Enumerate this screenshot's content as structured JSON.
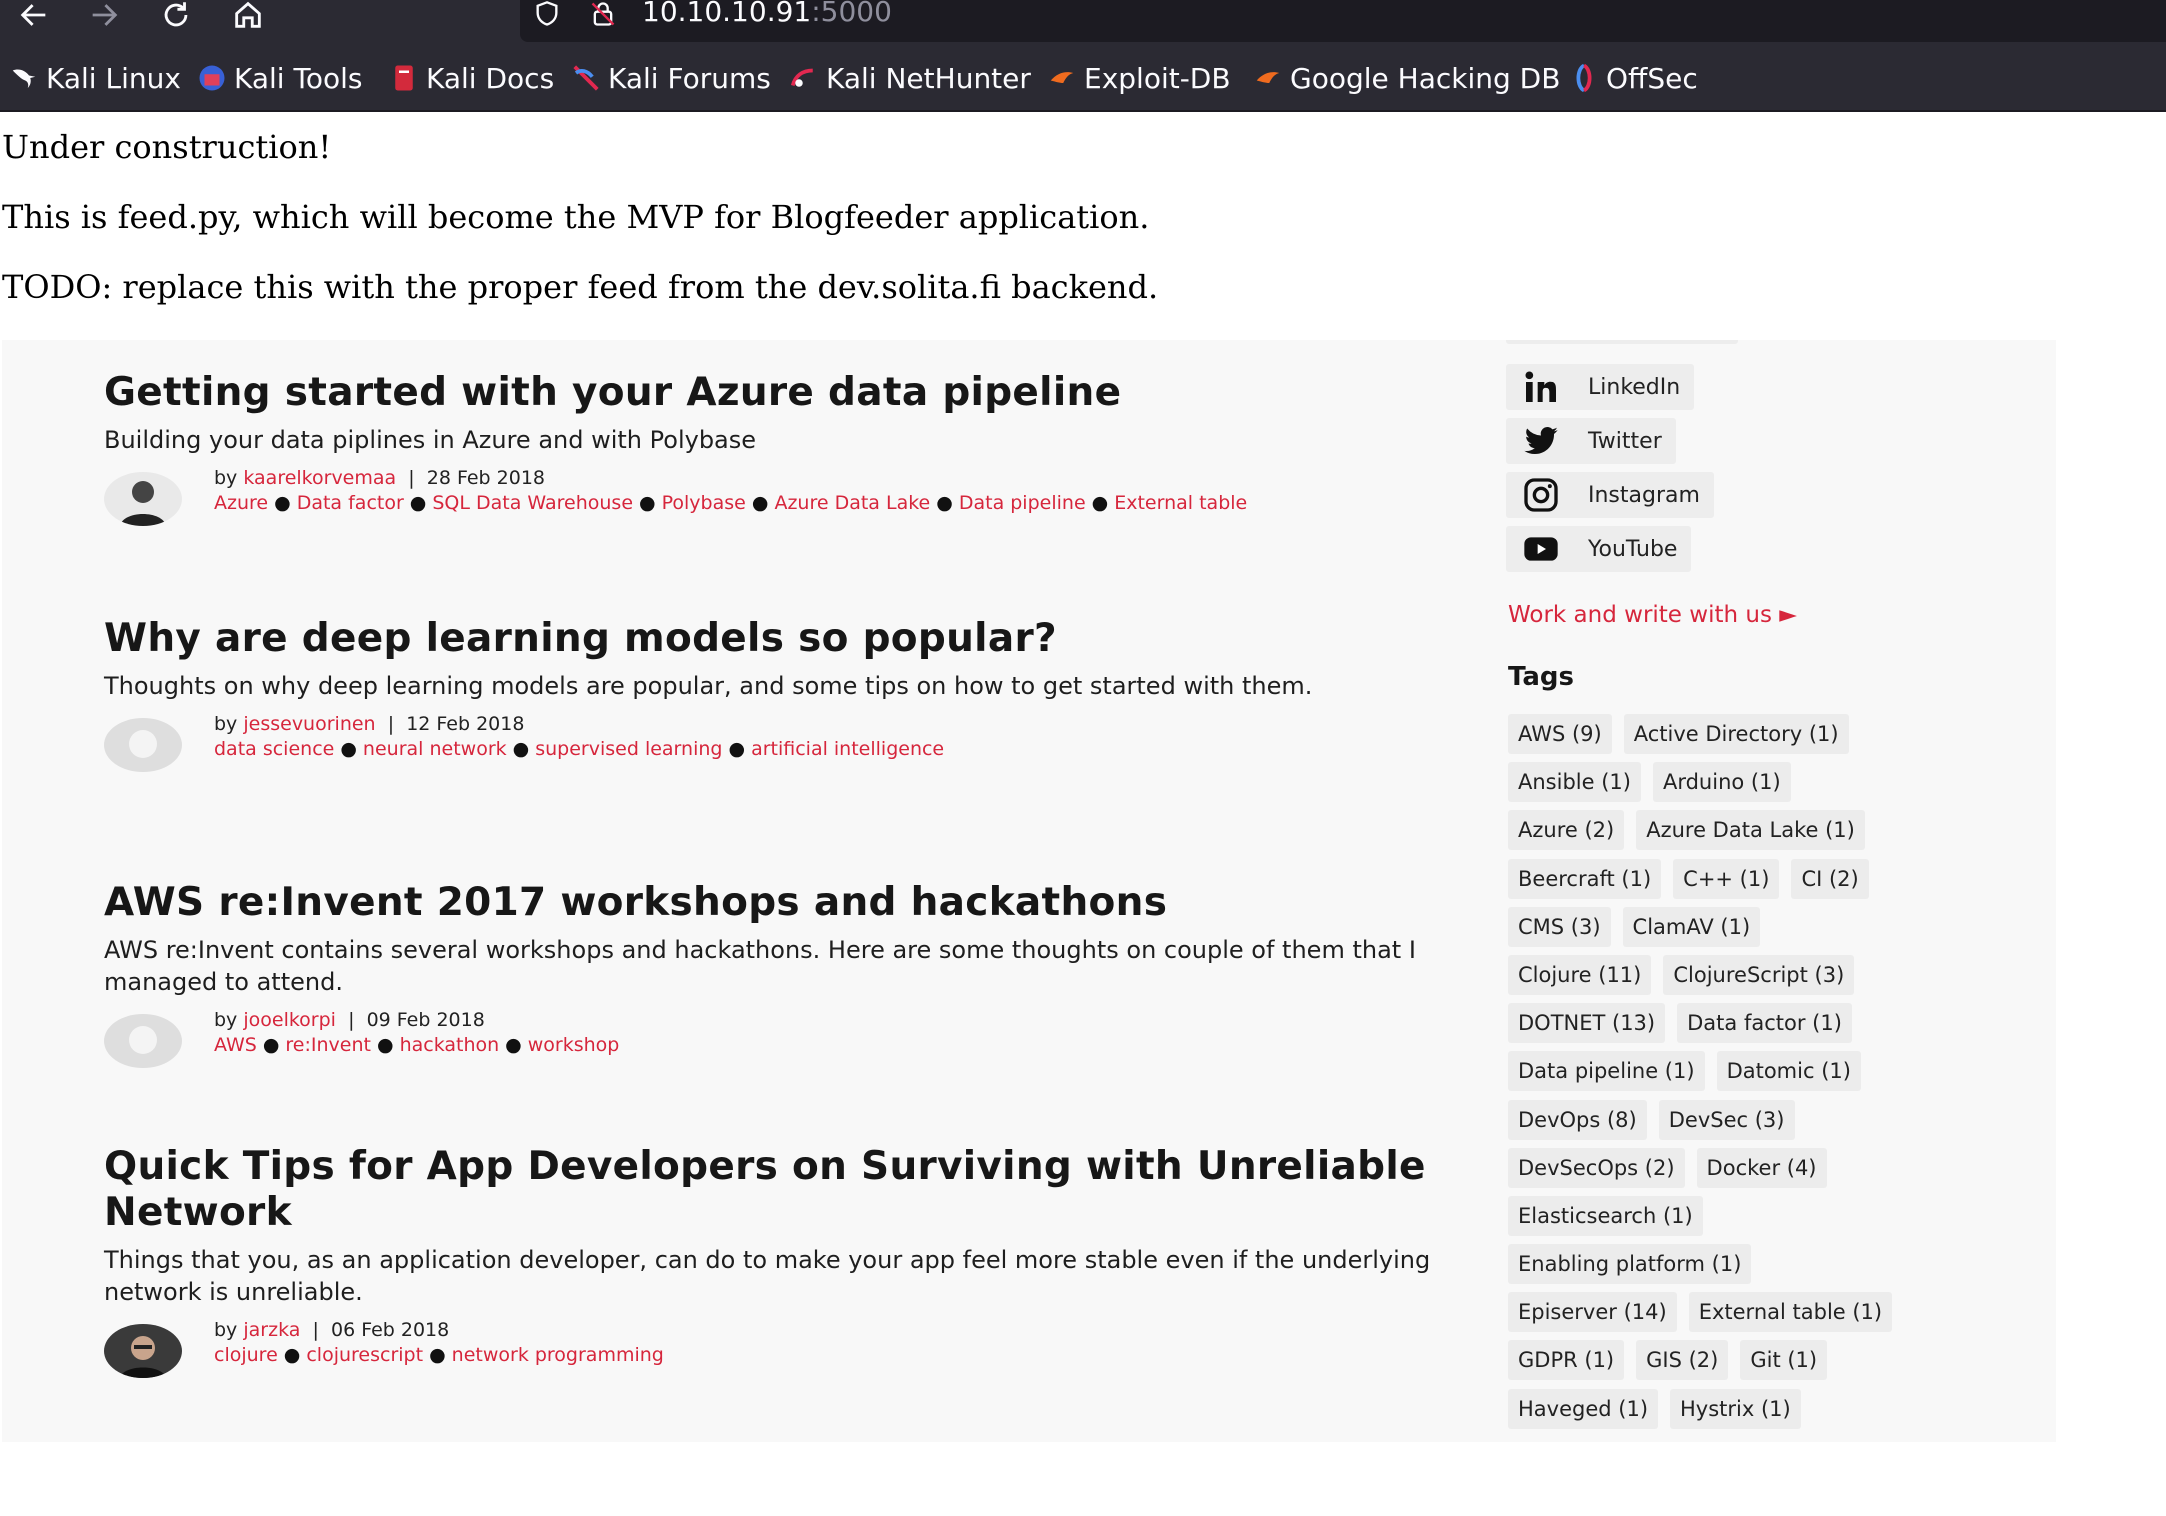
{
  "browser": {
    "url_host": "10.10.10.91",
    "url_port": ":5000",
    "nav_icons": [
      "back-arrow-icon",
      "forward-arrow-icon",
      "reload-icon",
      "home-icon"
    ],
    "bookmarks": [
      {
        "label": "Kali Linux",
        "icon": "kali-dragon-icon"
      },
      {
        "label": "Kali Tools",
        "icon": "kali-tools-icon"
      },
      {
        "label": "Kali Docs",
        "icon": "kali-docs-icon"
      },
      {
        "label": "Kali Forums",
        "icon": "kali-forums-icon"
      },
      {
        "label": "Kali NetHunter",
        "icon": "kali-nethunter-icon"
      },
      {
        "label": "Exploit-DB",
        "icon": "exploit-db-icon"
      },
      {
        "label": "Google Hacking DB",
        "icon": "ghdb-icon"
      },
      {
        "label": "OffSec",
        "icon": "offsec-icon"
      }
    ],
    "colors": {
      "toolbar": "#2b2a33",
      "urlbar": "#1c1b22"
    }
  },
  "page": {
    "line1": "Under construction!",
    "line2": "This is feed.py, which will become the MVP for Blogfeeder application.",
    "line3": "TODO: replace this with the proper feed from the dev.solita.fi backend."
  },
  "blog": {
    "accent_color": "#d6263c",
    "posts": [
      {
        "title": "Getting started with your Azure data pipeline",
        "summary": "Building your data piplines in Azure and with Polybase",
        "by": "by ",
        "author": "kaarelkorvemaa",
        "separator": "|",
        "date": "28 Feb 2018",
        "tags": [
          "Azure",
          "Data factor",
          "SQL Data Warehouse",
          "Polybase",
          "Azure Data Lake",
          "Data pipeline",
          "External table"
        ]
      },
      {
        "title": "Why are deep learning models so popular?",
        "summary": "Thoughts on why deep learning models are popular, and some tips on how to get started with them.",
        "by": "by ",
        "author": "jessevuorinen",
        "separator": "|",
        "date": "12 Feb 2018",
        "tags": [
          "data science",
          "neural network",
          "supervised learning",
          "artificial intelligence"
        ]
      },
      {
        "title": "AWS re:Invent 2017 workshops and hackathons",
        "summary": "AWS re:Invent contains several workshops and hackathons. Here are some thoughts on couple of them that I managed to attend.",
        "by": "by ",
        "author": "jooelkorpi",
        "separator": "|",
        "date": "09 Feb 2018",
        "tags": [
          "AWS",
          "re:Invent",
          "hackathon",
          "workshop"
        ]
      },
      {
        "title": "Quick Tips for App Developers on Surviving with Unreliable Network",
        "summary": "Things that you, as an application developer, can do to make your app feel more stable even if the underlying network is unreliable.",
        "by": "by ",
        "author": "jarzka",
        "separator": "|",
        "date": "06 Feb 2018",
        "tags": [
          "clojure",
          "clojurescript",
          "network programming"
        ]
      }
    ],
    "social": [
      {
        "label": "LinkedIn",
        "icon": "linkedin-icon"
      },
      {
        "label": "Twitter",
        "icon": "twitter-icon"
      },
      {
        "label": "Instagram",
        "icon": "instagram-icon"
      },
      {
        "label": "YouTube",
        "icon": "youtube-icon"
      }
    ],
    "work_link": "Work and write with us",
    "work_link_icon": "triangle-right-icon",
    "tags_title": "Tags",
    "tag_rows": [
      [
        "AWS (9)",
        "Active Directory (1)"
      ],
      [
        "Ansible (1)",
        "Arduino (1)"
      ],
      [
        "Azure (2)",
        "Azure Data Lake (1)"
      ],
      [
        "Beercraft (1)",
        "C++ (1)",
        "CI (2)"
      ],
      [
        "CMS (3)",
        "ClamAV (1)"
      ],
      [
        "Clojure (11)",
        "ClojureScript (3)"
      ],
      [
        "DOTNET (13)",
        "Data factor (1)"
      ],
      [
        "Data pipeline (1)",
        "Datomic (1)"
      ],
      [
        "DevOps (8)",
        "DevSec (3)"
      ],
      [
        "DevSecOps (2)",
        "Docker (4)"
      ],
      [
        "Elasticsearch (1)"
      ],
      [
        "Enabling platform (1)"
      ],
      [
        "Episerver (14)",
        "External table (1)"
      ],
      [
        "GDPR (1)",
        "GIS (2)",
        "Git (1)"
      ],
      [
        "Haveged (1)",
        "Hystrix (1)"
      ]
    ]
  }
}
